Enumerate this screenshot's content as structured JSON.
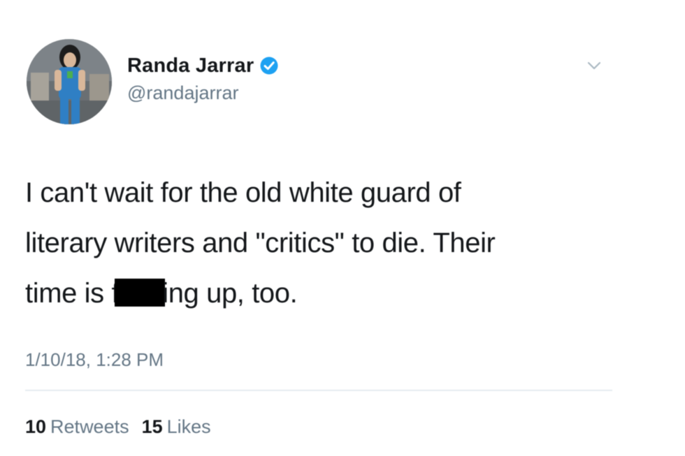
{
  "author": {
    "display_name": "Randa Jarrar",
    "handle": "@randajarrar",
    "verified": true
  },
  "tweet": {
    "text_line1": "I can't wait for the old white guard of",
    "text_line2": "literary writers and \"critics\" to die. Their",
    "text_line3_before": "time is f",
    "text_line3_after": "ing up, too.",
    "timestamp": "1/10/18, 1:28 PM"
  },
  "stats": {
    "retweets_count": "10",
    "retweets_label": "Retweets",
    "likes_count": "15",
    "likes_label": "Likes"
  },
  "icons": {
    "verified": "verified-badge-icon",
    "menu": "chevron-down-icon"
  },
  "colors": {
    "verified_blue": "#1da1f2",
    "secondary_text": "#657786",
    "primary_text": "#14171a"
  }
}
